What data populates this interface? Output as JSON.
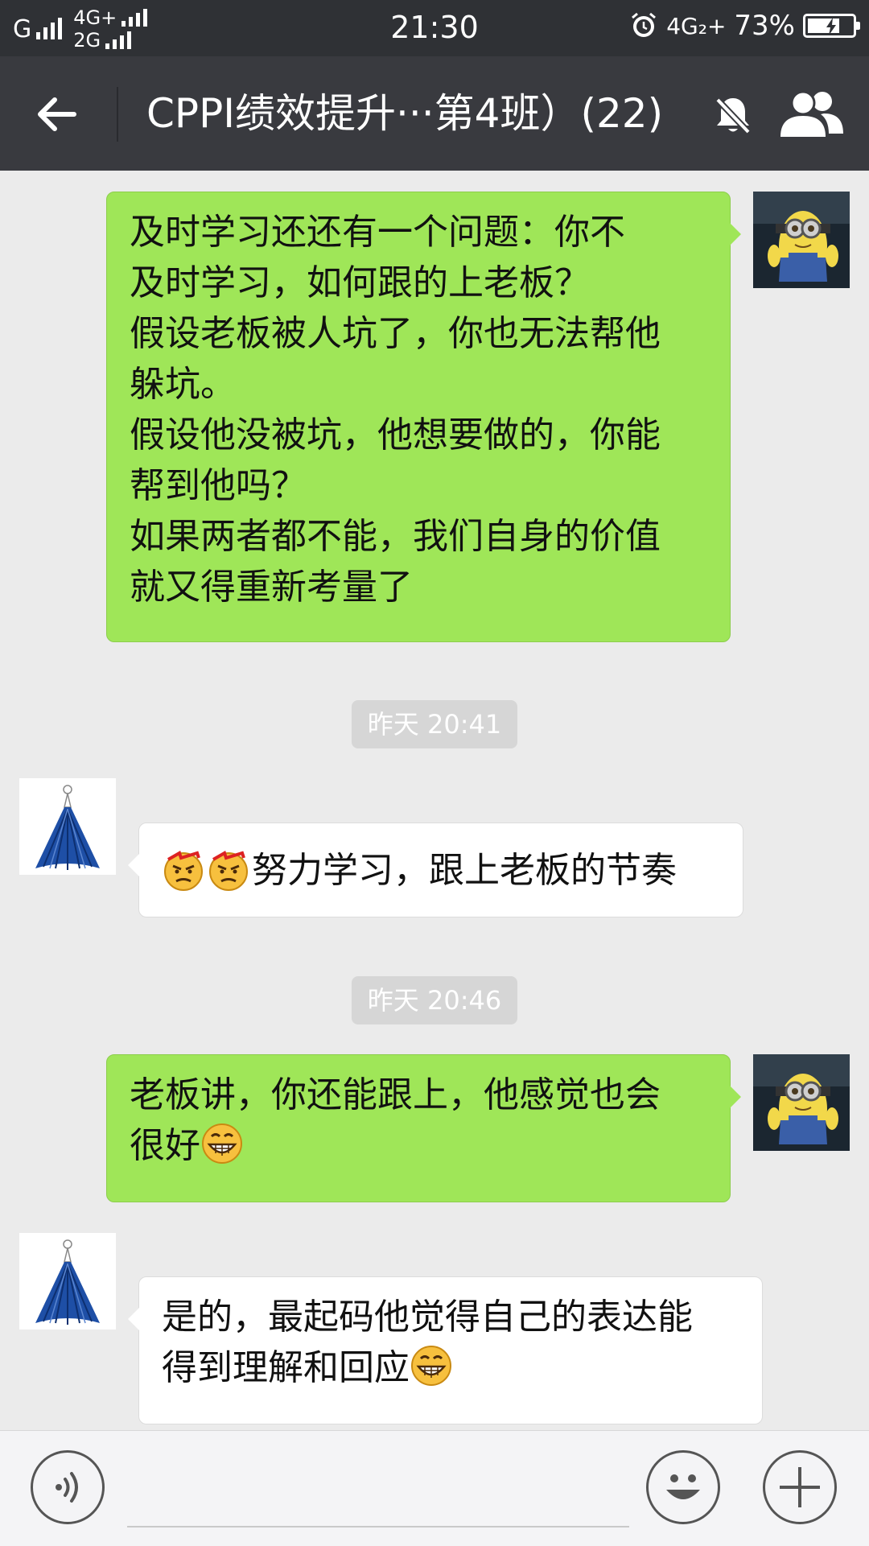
{
  "status_bar": {
    "carrier_g": "G",
    "net_top": "4G+",
    "net_bottom": "2G",
    "time": "21:30",
    "net_right": "4G₂+",
    "battery": "73%",
    "battery_level": 0.73
  },
  "header": {
    "title": "CPPI绩效提升···第4班）(22)",
    "back_icon": "arrow-left-icon",
    "mute_icon": "bell-off-icon",
    "members_icon": "group-icon"
  },
  "messages": [
    {
      "side": "out",
      "lines": [
        "及时学习还还有一个问题：你不",
        "及时学习，如何跟的上老板？",
        "假设老板被人坑了，你也无法帮他",
        "躲坑。",
        "假设他没被坑，他想要做的，你能",
        "帮到他吗？",
        "如果两者都不能，我们自身的价值",
        "就又得重新考量了"
      ]
    },
    {
      "timestamp": "昨天 20:41"
    },
    {
      "side": "in",
      "emoji": "angry-face-emoji",
      "text": "努力学习，跟上老板的节奏"
    },
    {
      "timestamp": "昨天 20:46"
    },
    {
      "side": "out",
      "lines": [
        "老板讲，你还能跟上，他感觉也会",
        "很好"
      ],
      "emoji": "grin-emoji"
    },
    {
      "side": "in",
      "lines": [
        "是的，最起码他觉得自己的表达能",
        "得到理解和回应"
      ],
      "emoji": "grin-emoji"
    }
  ],
  "input_bar": {
    "voice_icon": "voice-icon",
    "emoji_icon": "smiley-icon",
    "plus_icon": "plus-icon",
    "placeholder": ""
  }
}
